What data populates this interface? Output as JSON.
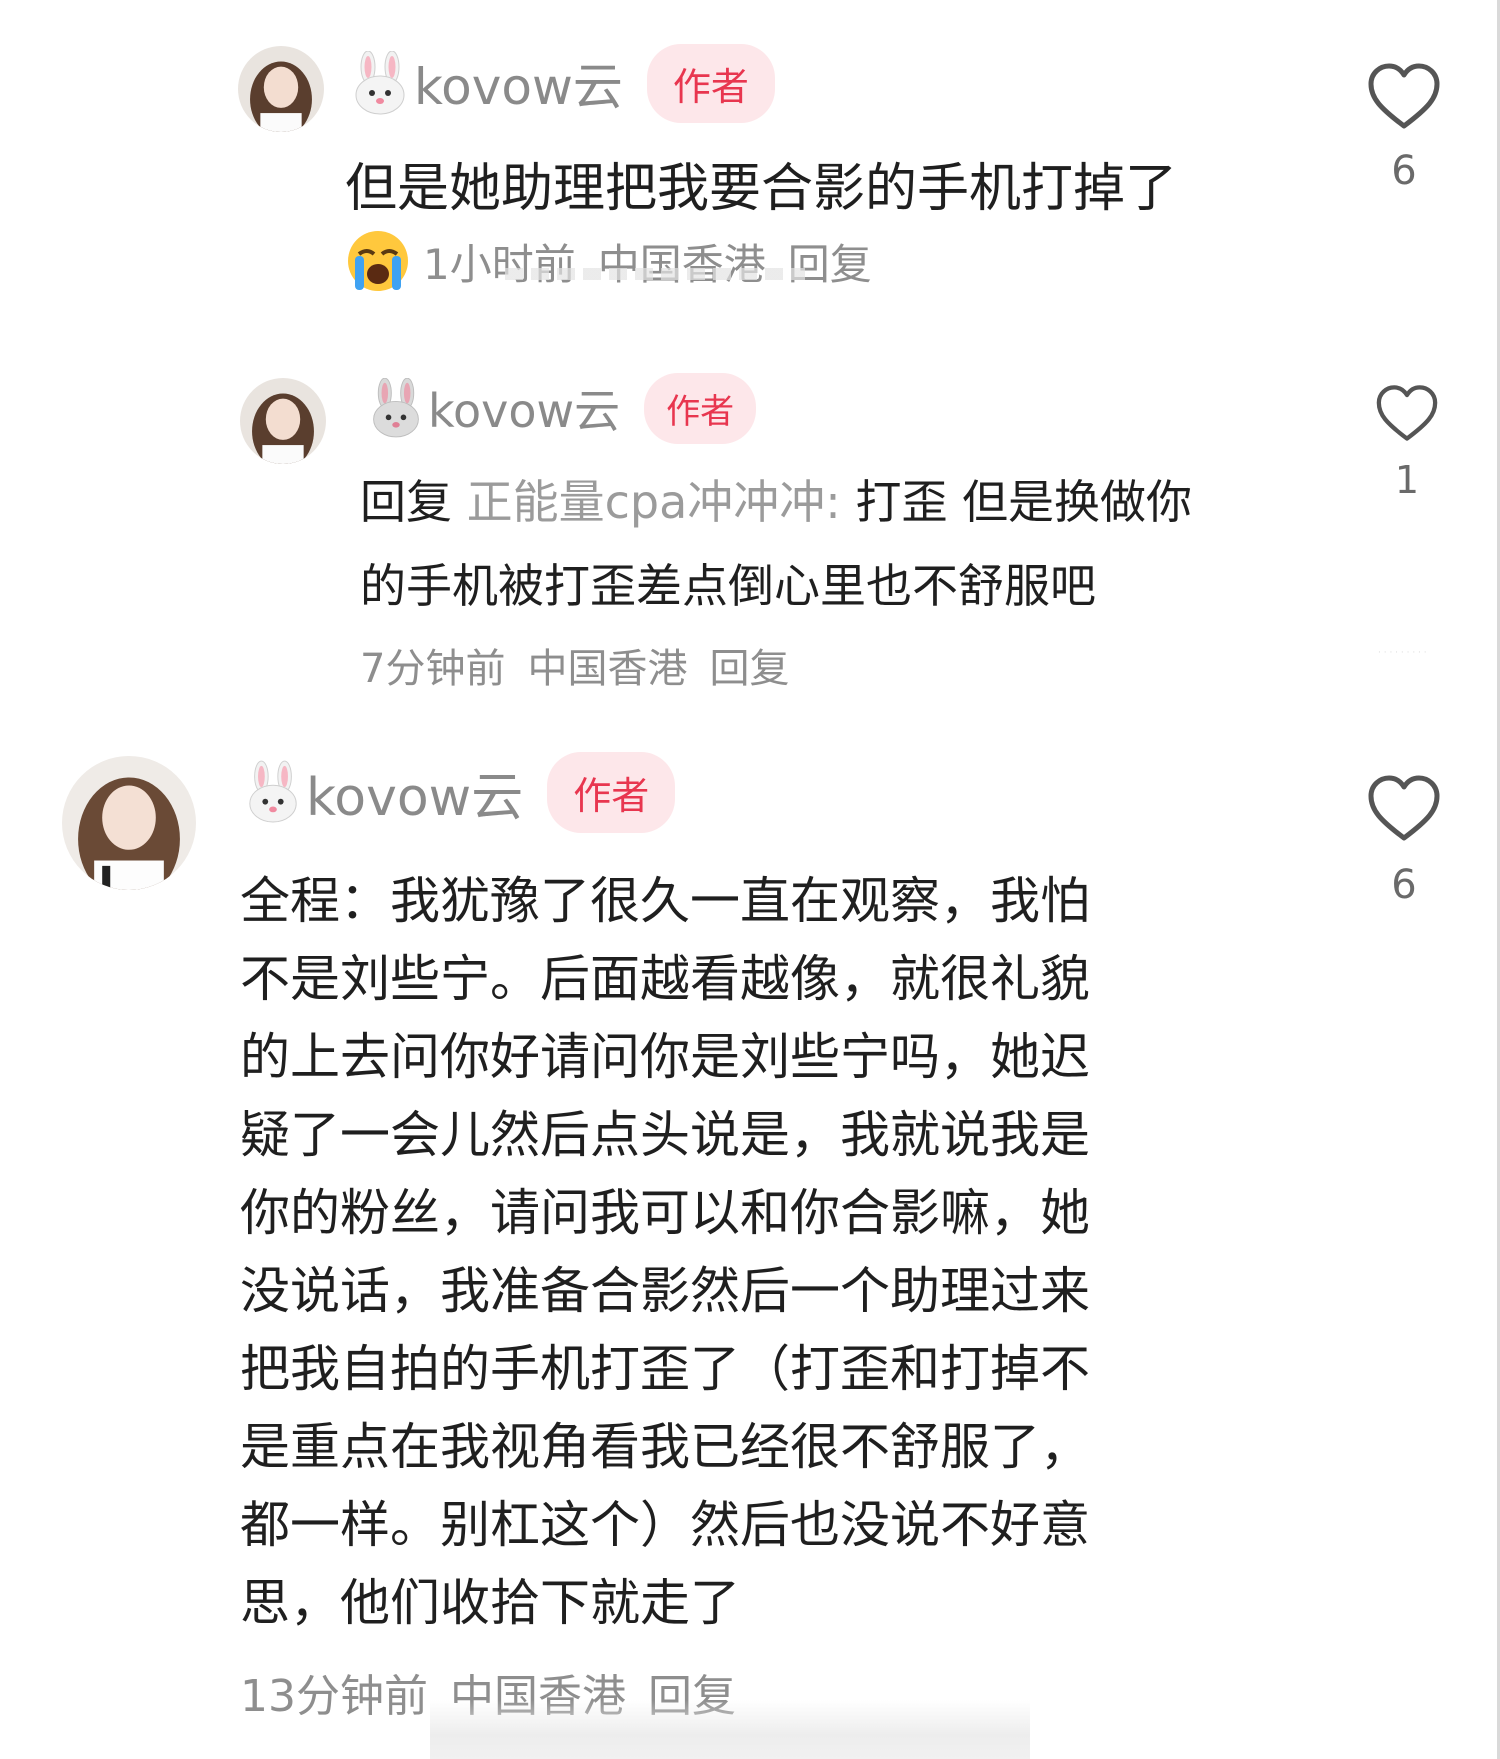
{
  "colors": {
    "badge_bg": "#fde7ea",
    "badge_text": "#e8364f",
    "meta": "#8e8e8e",
    "mention": "#9b9b9b"
  },
  "comments": [
    {
      "username": "kovow云",
      "badge": "作者",
      "name_emoji": "rabbit-face",
      "text": "但是她助理把我要合影的手机打掉了",
      "trailing_emoji": "loudly-crying-face",
      "time": "1小时前",
      "location": "中国香港",
      "reply_label": "回复",
      "likes": "6"
    },
    {
      "username": "kovow云",
      "badge": "作者",
      "name_emoji": "rabbit-face",
      "reply_prefix": "回复",
      "reply_to": "正能量cpa冲冲冲:",
      "text_line1": "打歪 但是换做你",
      "text_line2": "的手机被打歪差点倒心里也不舒服吧",
      "time": "7分钟前",
      "location": "中国香港",
      "reply_label": "回复",
      "likes": "1"
    },
    {
      "username": "kovow云",
      "badge": "作者",
      "name_emoji": "rabbit-face",
      "lines": [
        "全程：我犹豫了很久一直在观察，我怕",
        "不是刘些宁。后面越看越像，就很礼貌",
        "的上去问你好请问你是刘些宁吗，她迟",
        "疑了一会儿然后点头说是，我就说我是",
        "你的粉丝，请问我可以和你合影嘛，她",
        "没说话，我准备合影然后一个助理过来",
        "把我自拍的手机打歪了（打歪和打掉不",
        "是重点在我视角看我已经很不舒服了，",
        "都一样。别杠这个）然后也没说不好意",
        "思，他们收拾下就走了"
      ],
      "time": "13分钟前",
      "location": "中国香港",
      "reply_label": "回复",
      "likes": "6"
    }
  ]
}
